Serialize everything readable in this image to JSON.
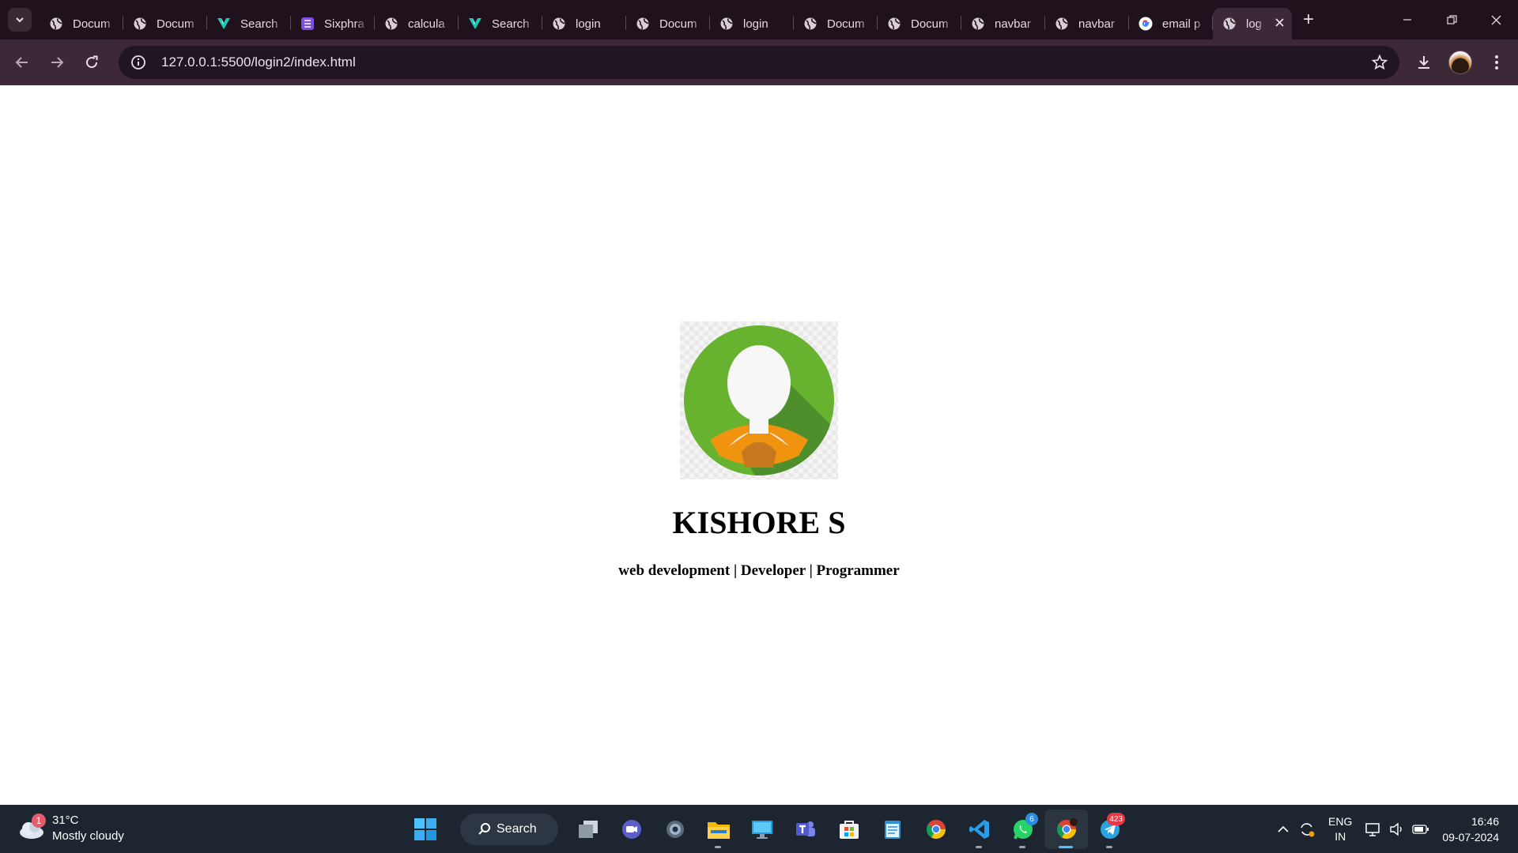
{
  "browser": {
    "tabs": [
      {
        "label": "Docum",
        "icon": "globe-icon"
      },
      {
        "label": "Docum",
        "icon": "globe-icon"
      },
      {
        "label": "Search",
        "icon": "vuetify-icon"
      },
      {
        "label": "Sixphra",
        "icon": "list-app-icon"
      },
      {
        "label": "calcula",
        "icon": "globe-icon"
      },
      {
        "label": "Search",
        "icon": "vuetify-icon"
      },
      {
        "label": "login",
        "icon": "globe-icon"
      },
      {
        "label": "Docum",
        "icon": "globe-icon"
      },
      {
        "label": "login",
        "icon": "globe-icon"
      },
      {
        "label": "Docum",
        "icon": "globe-icon"
      },
      {
        "label": "Docum",
        "icon": "globe-icon"
      },
      {
        "label": "navbar",
        "icon": "globe-icon"
      },
      {
        "label": "navbar",
        "icon": "globe-icon"
      },
      {
        "label": "email p",
        "icon": "google-icon"
      },
      {
        "label": "log",
        "icon": "globe-icon",
        "active": true
      }
    ],
    "url": "127.0.0.1:5500/login2/index.html",
    "colors": {
      "frame": "#1f121c",
      "toolbar": "#3d2837",
      "omnibox": "#201520"
    }
  },
  "page": {
    "name": "KISHORE S",
    "tagline": "web development | Developer | Programmer",
    "avatar_colors": {
      "circle": "#67b22e",
      "shadow": "#4f8f2b",
      "collar": "#f0930e"
    }
  },
  "taskbar": {
    "weather": {
      "temp": "31°C",
      "condition": "Mostly cloudy",
      "badge": "1"
    },
    "search_label": "Search",
    "apps": [
      {
        "name": "task-view-icon"
      },
      {
        "name": "meet-icon"
      },
      {
        "name": "settings-icon"
      },
      {
        "name": "file-explorer-icon",
        "running": true
      },
      {
        "name": "desktop-icon"
      },
      {
        "name": "teams-icon"
      },
      {
        "name": "store-icon"
      },
      {
        "name": "notepad-icon"
      },
      {
        "name": "chrome-icon"
      },
      {
        "name": "vscode-icon",
        "running": true
      },
      {
        "name": "whatsapp-icon",
        "badge": "6",
        "running": true
      },
      {
        "name": "chrome-profile-icon",
        "running": true,
        "active": true
      },
      {
        "name": "telegram-icon",
        "badge": "423",
        "running": true
      }
    ],
    "language": {
      "line1": "ENG",
      "line2": "IN"
    },
    "time": "16:46",
    "date": "09-07-2024"
  }
}
